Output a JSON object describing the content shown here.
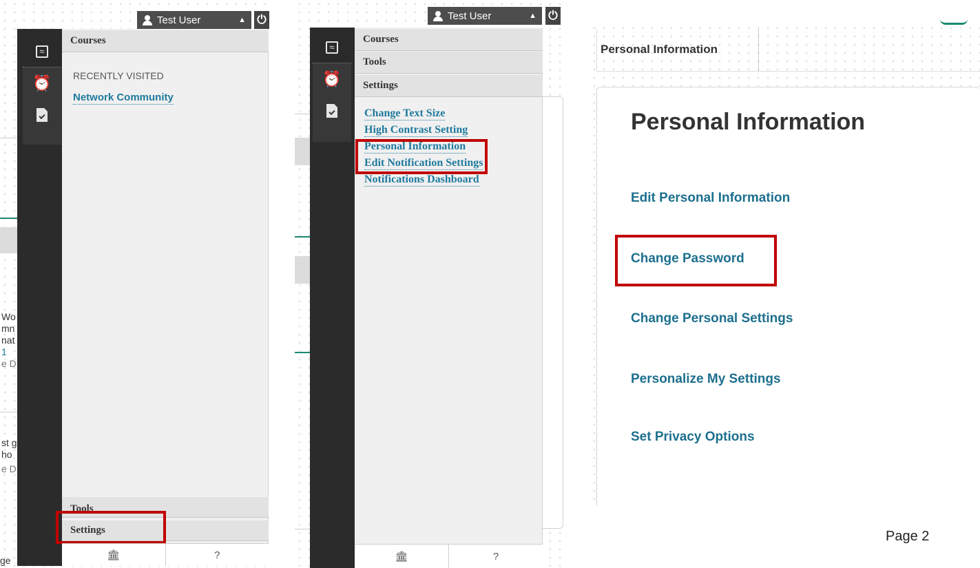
{
  "topbar": {
    "user_name": "Test User",
    "caret": "▲",
    "power_glyph": "⏻"
  },
  "panel1": {
    "courses_header": "Courses",
    "recently_visited_label": "RECENTLY VISITED",
    "recent_link": "Network Community",
    "tools_header": "Tools",
    "settings_header": "Settings",
    "footer_home_glyph": "🏛",
    "footer_help": "?"
  },
  "panel2": {
    "courses_header": "Courses",
    "tools_header": "Tools",
    "settings_header": "Settings",
    "links": [
      "Change Text Size",
      "High Contrast Setting",
      "Personal Information",
      "Edit Notification Settings",
      "Notifications Dashboard"
    ],
    "footer_home_glyph": "🏛",
    "footer_help": "?"
  },
  "page3": {
    "tab_label": "Personal Information",
    "title": "Personal Information",
    "links": [
      "Edit Personal Information",
      "Change Password",
      "Change Personal Settings",
      "Personalize My Settings",
      "Set Privacy Options"
    ]
  },
  "background_fragments": {
    "lines_a": [
      "Wo",
      "mn",
      "nat",
      "1",
      "e D"
    ],
    "lines_b": [
      "st g",
      "ho",
      "e D"
    ],
    "bottom": "ge"
  },
  "page_number": "Page 2",
  "colors": {
    "highlight_red": "#c00000",
    "link_blue": "#1f7a9e",
    "rail_dark": "#2b2b2b"
  }
}
